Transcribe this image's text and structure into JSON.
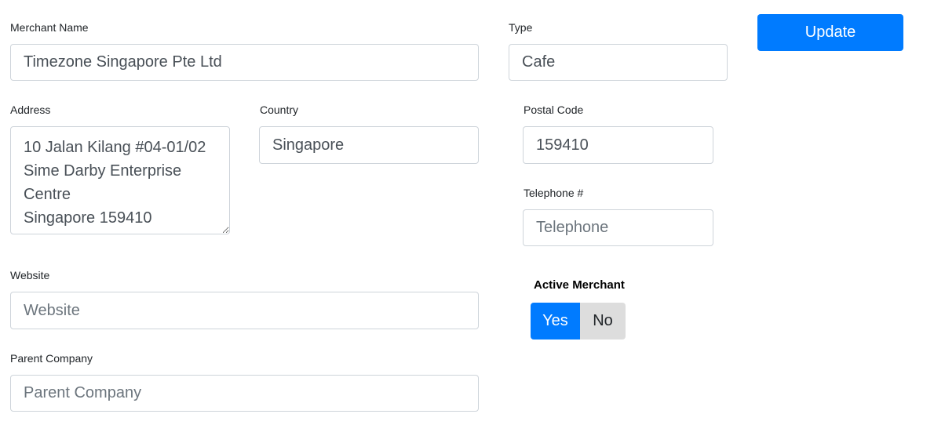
{
  "form": {
    "merchant_name": {
      "label": "Merchant Name",
      "value": "Timezone Singapore Pte Ltd",
      "placeholder": "Merchant Name"
    },
    "type": {
      "label": "Type",
      "value": "Cafe",
      "placeholder": "Type"
    },
    "address": {
      "label": "Address",
      "value": "10 Jalan Kilang #04-01/02\nSime Darby Enterprise Centre\nSingapore 159410"
    },
    "country": {
      "label": "Country",
      "value": "Singapore",
      "placeholder": "Country"
    },
    "postal_code": {
      "label": "Postal Code",
      "value": "159410",
      "placeholder": "Postal Code"
    },
    "telephone": {
      "label": "Telephone #",
      "value": "",
      "placeholder": "Telephone"
    },
    "website": {
      "label": "Website",
      "value": "",
      "placeholder": "Website"
    },
    "parent_company": {
      "label": "Parent Company",
      "value": "",
      "placeholder": "Parent Company"
    },
    "active_merchant": {
      "label": "Active Merchant",
      "yes_label": "Yes",
      "no_label": "No",
      "selected": "Yes"
    }
  },
  "actions": {
    "update_label": "Update"
  },
  "colors": {
    "primary": "#007bff",
    "toggle_inactive": "#dddddd",
    "input_border": "#ced4da"
  }
}
